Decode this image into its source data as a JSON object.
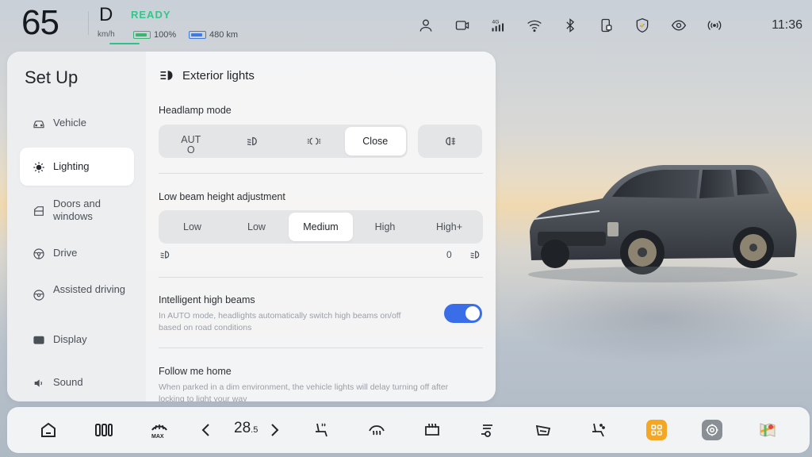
{
  "status_bar": {
    "speed": "65",
    "speed_unit": "km/h",
    "gear": "D",
    "ready": "READY",
    "battery_percent": "100%",
    "range": "480 km",
    "time": "11:36",
    "network": "4G",
    "icons": [
      "person-icon",
      "dashcam-icon",
      "cellular-4g-icon",
      "wifi-icon",
      "bluetooth-icon",
      "card-icon",
      "shield-icon",
      "eye-icon",
      "hotspot-icon"
    ]
  },
  "panel": {
    "title": "Set Up",
    "nav": [
      {
        "label": "Vehicle",
        "icon": "car-icon"
      },
      {
        "label": "Lighting",
        "icon": "lightbulb-icon",
        "active": true
      },
      {
        "label": "Doors and windows",
        "icon": "door-icon"
      },
      {
        "label": "Drive",
        "icon": "steering-wheel-icon"
      },
      {
        "label": "Assisted driving",
        "icon": "assist-wheel-icon"
      },
      {
        "label": "Display",
        "icon": "display-icon"
      },
      {
        "label": "Sound",
        "icon": "speaker-icon"
      }
    ],
    "section_title": "Exterior lights",
    "headlamp": {
      "label": "Headlamp mode",
      "auto_line1": "AUT",
      "auto_line2": "O",
      "selected": "Close",
      "options": [
        "AUTO",
        "low-beam-icon",
        "position-lights-icon",
        "Close"
      ],
      "fog_icon": "fog-light-icon"
    },
    "low_beam": {
      "label": "Low beam height adjustment",
      "options": [
        "Low",
        "Low",
        "Medium",
        "High",
        "High+"
      ],
      "selected": "Medium",
      "min_value": "0"
    },
    "intelligent_high_beams": {
      "label": "Intelligent high beams",
      "description": "In AUTO mode, headlights automatically switch high beams on/off based on road conditions",
      "enabled": true
    },
    "follow_me_home": {
      "label": "Follow me home",
      "description": "When parked in a dim environment, the vehicle lights will delay turning off after locking to light your way"
    }
  },
  "dock": {
    "temperature": "28",
    "temperature_decimal": ".5",
    "items": [
      "home-icon",
      "split-view-icon",
      "max-defrost-icon",
      "temp-down-icon",
      "temp-up-icon",
      "seat-heat-icon",
      "front-defrost-icon",
      "rear-defrost-icon",
      "fan-icon",
      "seat-ventilation-icon",
      "massage-seat-icon",
      "apps-icon",
      "settings-icon",
      "maps-icon"
    ],
    "colors": {
      "apps": "#f5a623",
      "settings": "#8a8f96"
    }
  },
  "colors": {
    "ready_green": "#35c58a",
    "toggle_blue": "#3a6ee8"
  }
}
